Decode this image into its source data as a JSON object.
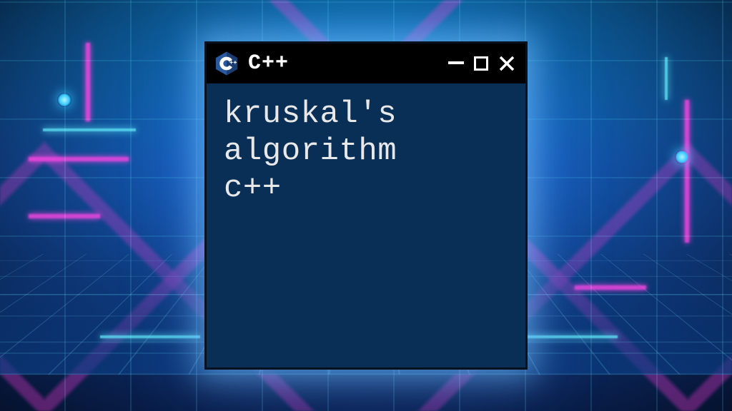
{
  "window": {
    "title": "C++",
    "icon": "cpp-logo-icon",
    "content": "kruskal's\nalgorithm\nc++"
  },
  "controls": {
    "minimize": "minimize-icon",
    "maximize": "maximize-icon",
    "close": "close-icon"
  },
  "colors": {
    "window_bg": "#0a2f57",
    "titlebar_bg": "#000000",
    "text": "#e8e8e8",
    "glow": "#78c8ff",
    "accent_pink": "#ff46e6",
    "accent_cyan": "#64f0ff"
  }
}
